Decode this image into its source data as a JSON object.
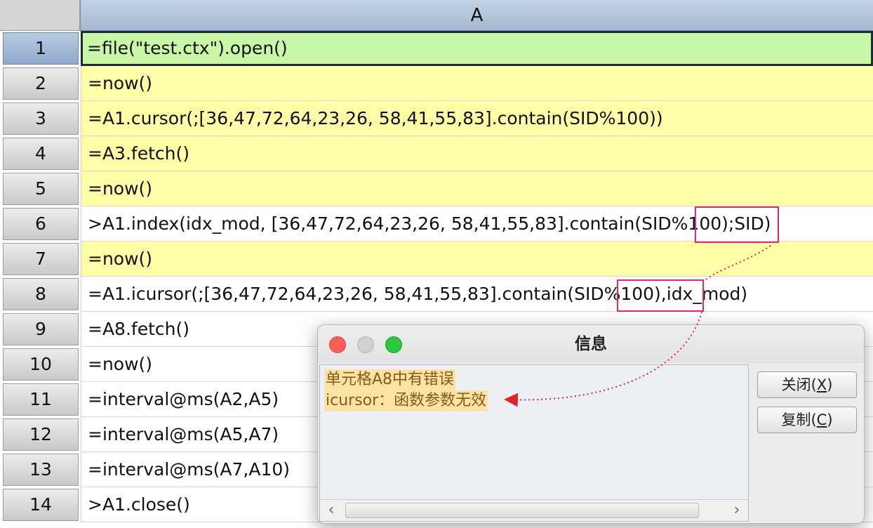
{
  "sheet": {
    "column_header": "A",
    "selected_row": 1,
    "rows": [
      {
        "num": "1",
        "formula": "=file(\"test.ctx\").open()"
      },
      {
        "num": "2",
        "formula": "=now()"
      },
      {
        "num": "3",
        "formula": "=A1.cursor(;[36,47,72,64,23,26, 58,41,55,83].contain(SID%100))"
      },
      {
        "num": "4",
        "formula": "=A3.fetch()"
      },
      {
        "num": "5",
        "formula": "=now()"
      },
      {
        "num": "6",
        "formula": ">A1.index(idx_mod, [36,47,72,64,23,26, 58,41,55,83].contain(SID%100);SID)"
      },
      {
        "num": "7",
        "formula": "=now()"
      },
      {
        "num": "8",
        "formula": "=A1.icursor(;[36,47,72,64,23,26, 58,41,55,83].contain(SID%100),idx_mod)"
      },
      {
        "num": "9",
        "formula": "=A8.fetch()"
      },
      {
        "num": "10",
        "formula": "=now()"
      },
      {
        "num": "11",
        "formula": "=interval@ms(A2,A5)"
      },
      {
        "num": "12",
        "formula": "=interval@ms(A5,A7)"
      },
      {
        "num": "13",
        "formula": "=interval@ms(A7,A10)"
      },
      {
        "num": "14",
        "formula": ">A1.close()"
      }
    ]
  },
  "dialog": {
    "title": "信息",
    "message_line1": "单元格A8中有错误",
    "message_line2": "icursor：函数参数无效",
    "close_label": "关闭(",
    "close_key": "X",
    "copy_label": "复制(",
    "copy_key": "C",
    "paren_close": ")",
    "scroll_left": "‹",
    "scroll_right": "›"
  },
  "colors": {
    "cell_green": "#c9f7a8",
    "cell_yellow": "#fefea8",
    "highlight_box": "#e0287a",
    "arrow": "#e0242b"
  }
}
